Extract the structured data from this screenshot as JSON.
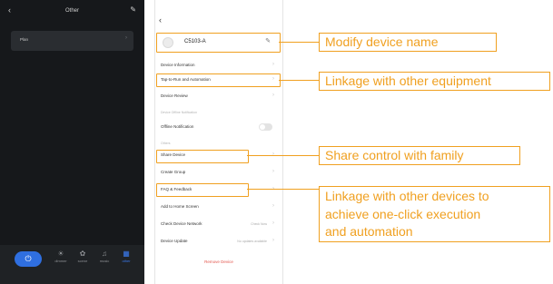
{
  "left_phone": {
    "back_icon": "chevron-left-icon",
    "title": "Other",
    "edit_icon": "pencil-icon",
    "card_label": "Plan",
    "power_icon": "power-icon",
    "modes": [
      {
        "label": "dimmer",
        "icon": "bulb-icon",
        "active": false
      },
      {
        "label": "scene",
        "icon": "palette-icon",
        "active": false
      },
      {
        "label": "music",
        "icon": "music-icon",
        "active": false
      },
      {
        "label": "other",
        "icon": "grid-icon",
        "active": true
      }
    ],
    "accent": "#2f6fe0"
  },
  "settings_phone": {
    "back_icon": "chevron-left-icon",
    "device_name": "C5103-A",
    "edit_icon": "pencil-icon",
    "items": {
      "device_information": "Device Information",
      "tap_to_run": "Tap-to-Run and Automation",
      "device_review": "Device Review",
      "offline_section": "Device Offline Notification",
      "offline_notification": "Offline Notification",
      "others_section": "Others",
      "share_device": "Share Device",
      "create_group": "Create Group",
      "faq": "FAQ & Feedback",
      "add_home": "Add to Home Screen",
      "check_network": "Check Device Network",
      "check_network_value": "Check Now",
      "device_update": "Device Update",
      "device_update_value": "No updates available",
      "remove": "Remove Device"
    }
  },
  "callouts": {
    "modify_name": "Modify device name",
    "linkage_equipment": "Linkage with other equipment",
    "share_control": "Share control with family",
    "linkage_devices_line1": "Linkage with other devices to",
    "linkage_devices_line2": "achieve one-click execution",
    "linkage_devices_line3": "and automation"
  },
  "colors": {
    "highlight": "#f0a020",
    "danger": "#e2534a",
    "dark_bg": "#16181b"
  }
}
